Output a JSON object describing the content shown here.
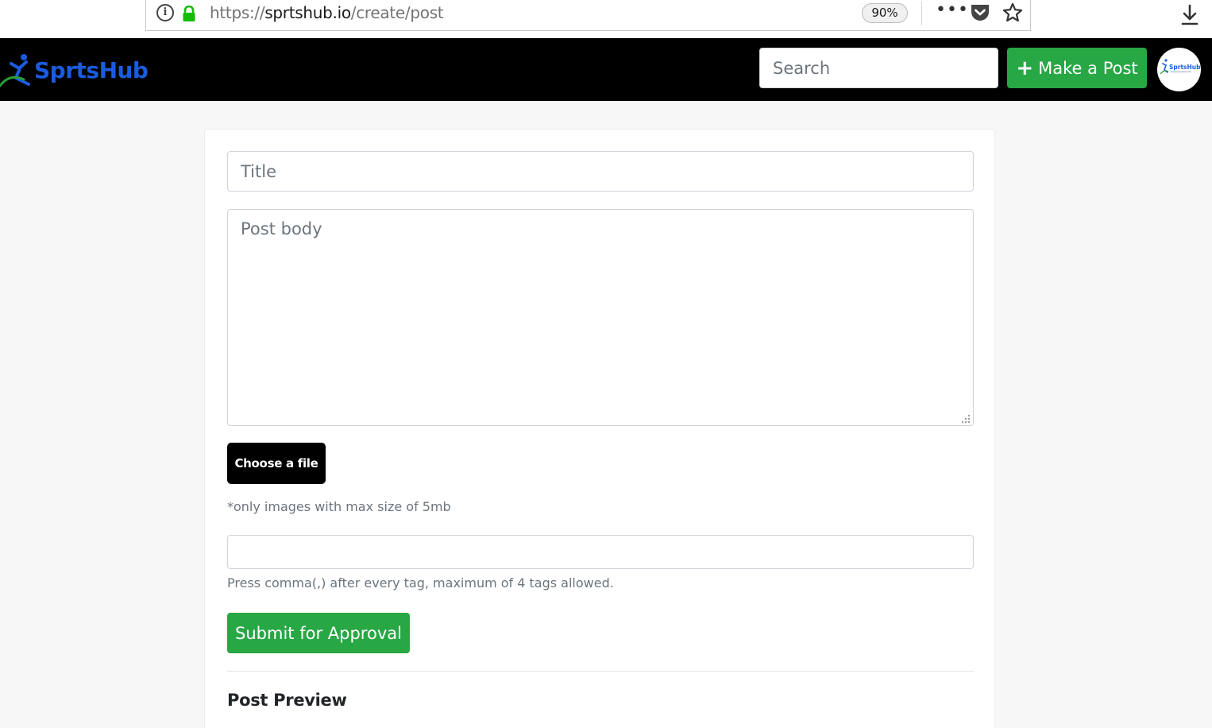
{
  "browser": {
    "url_scheme": "https://",
    "url_domain": "sprtshub.io",
    "url_path": "/create/post",
    "zoom": "90%",
    "menu_icon": "ellipsis-icon",
    "pocket_icon": "pocket-icon",
    "bookmark_icon": "star-icon",
    "download_icon": "download-icon"
  },
  "navbar": {
    "brand": "SprtsHub",
    "search_placeholder": "Search",
    "make_post_label": "Make a Post",
    "plus_symbol": "+",
    "avatar_text": "SprtsHub"
  },
  "form": {
    "title_placeholder": "Title",
    "body_placeholder": "Post body",
    "choose_file_label": "Choose a file",
    "file_hint": "*only images with max size of 5mb",
    "tags_value": "",
    "tags_hint": "Press comma(,) after every tag, maximum of 4 tags allowed.",
    "submit_label": "Submit for Approval"
  },
  "preview": {
    "heading": "Post Preview"
  },
  "colors": {
    "brand_blue": "#1a5ce0",
    "success_green": "#28a745",
    "navbar_bg": "#000000",
    "page_bg": "#f7f7f7"
  }
}
